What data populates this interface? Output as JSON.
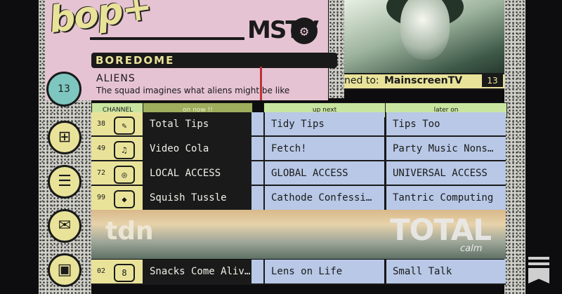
{
  "brand": {
    "logo": "bop+",
    "network_logo": "MSTV"
  },
  "current": {
    "channel_name": "BOREDOME",
    "channel_number": "13",
    "show_title": "ALIENS",
    "show_description": "The squad imagines what aliens might be like"
  },
  "player": {
    "tuned_prefix": "ned to:",
    "tuned_network": "MainscreenTV",
    "tuned_number": "13"
  },
  "guide": {
    "headers": {
      "channel": "CHANNEL",
      "now": "on now !!",
      "next": "up next",
      "later": "later on"
    },
    "rows": [
      {
        "channel": "38",
        "icon": "tips-icon",
        "now": "Total Tips",
        "next": "Tidy Tips",
        "later": "Tips Too"
      },
      {
        "channel": "49",
        "icon": "dancers-icon",
        "now": "Video Cola",
        "next": "Fetch!",
        "later": "Party Music Nons…"
      },
      {
        "channel": "72",
        "icon": "ad-icon",
        "now": "LOCAL ACCESS",
        "next": "GLOBAL ACCESS",
        "later": "UNIVERSAL ACCESS"
      },
      {
        "channel": "99",
        "icon": "cheese-icon",
        "now": "Squish Tussle",
        "next": "Cathode Confessi…",
        "later": "Tantric Computing"
      },
      {
        "channel": "02",
        "icon": "snacks-icon",
        "now": "Snacks Come Aliv…",
        "next": "Lens on Life",
        "later": "Small Talk"
      }
    ]
  },
  "promo": {
    "left_logo": "tdn",
    "title": "TOTAL",
    "subtitle": "calm"
  },
  "sidebar": {
    "icons": [
      "guide-icon",
      "list-icon",
      "mail-icon",
      "tv-icon"
    ]
  }
}
